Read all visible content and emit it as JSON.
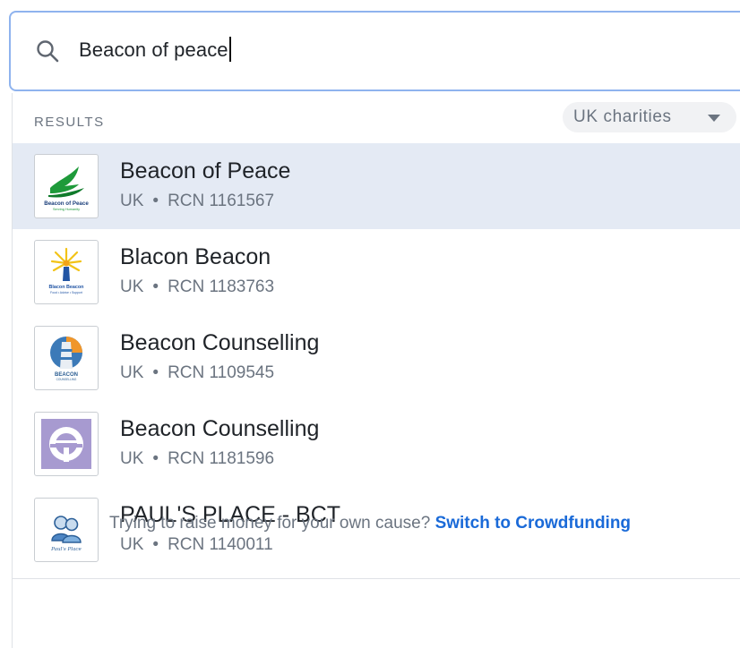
{
  "search": {
    "value": "Beacon of peace",
    "icon": "search-icon"
  },
  "results": {
    "header": "RESULTS",
    "filter": {
      "selected": "UK charities",
      "icon": "chevron-down-icon"
    },
    "items": [
      {
        "name": "Beacon of Peace",
        "country": "UK",
        "separator": "•",
        "rcn": "RCN 1161567",
        "logo": "beacon-of-peace-logo",
        "logo_text": "Beacon of Peace",
        "logo_subtext": "Serving Humanity",
        "selected": true
      },
      {
        "name": "Blacon Beacon",
        "country": "UK",
        "separator": "•",
        "rcn": "RCN 1183763",
        "logo": "blacon-beacon-logo",
        "logo_text": "Blacon Beacon",
        "logo_subtext": "Food • Advice • Support",
        "selected": false
      },
      {
        "name": "Beacon Counselling",
        "country": "UK",
        "separator": "•",
        "rcn": "RCN 1109545",
        "logo": "beacon-counselling-lighthouse-logo",
        "logo_text": "BEACON",
        "logo_subtext": "COUNSELLING",
        "selected": false
      },
      {
        "name": "Beacon Counselling",
        "country": "UK",
        "separator": "•",
        "rcn": "RCN 1181596",
        "logo": "beacon-counselling-purple-logo",
        "selected": false
      },
      {
        "name": "PAUL'S PLACE - BCT",
        "country": "UK",
        "separator": "•",
        "rcn": "RCN 1140011",
        "logo": "pauls-place-logo",
        "logo_text": "Paul's Place",
        "selected": false
      }
    ]
  },
  "footer": {
    "prompt": "Trying to raise money for your own cause?",
    "link": "Switch to Crowdfunding"
  },
  "colors": {
    "accent": "#1a6ad8",
    "selected_row": "#e4eaf4",
    "search_border": "#8fb3ee",
    "muted_text": "#6b7480"
  }
}
